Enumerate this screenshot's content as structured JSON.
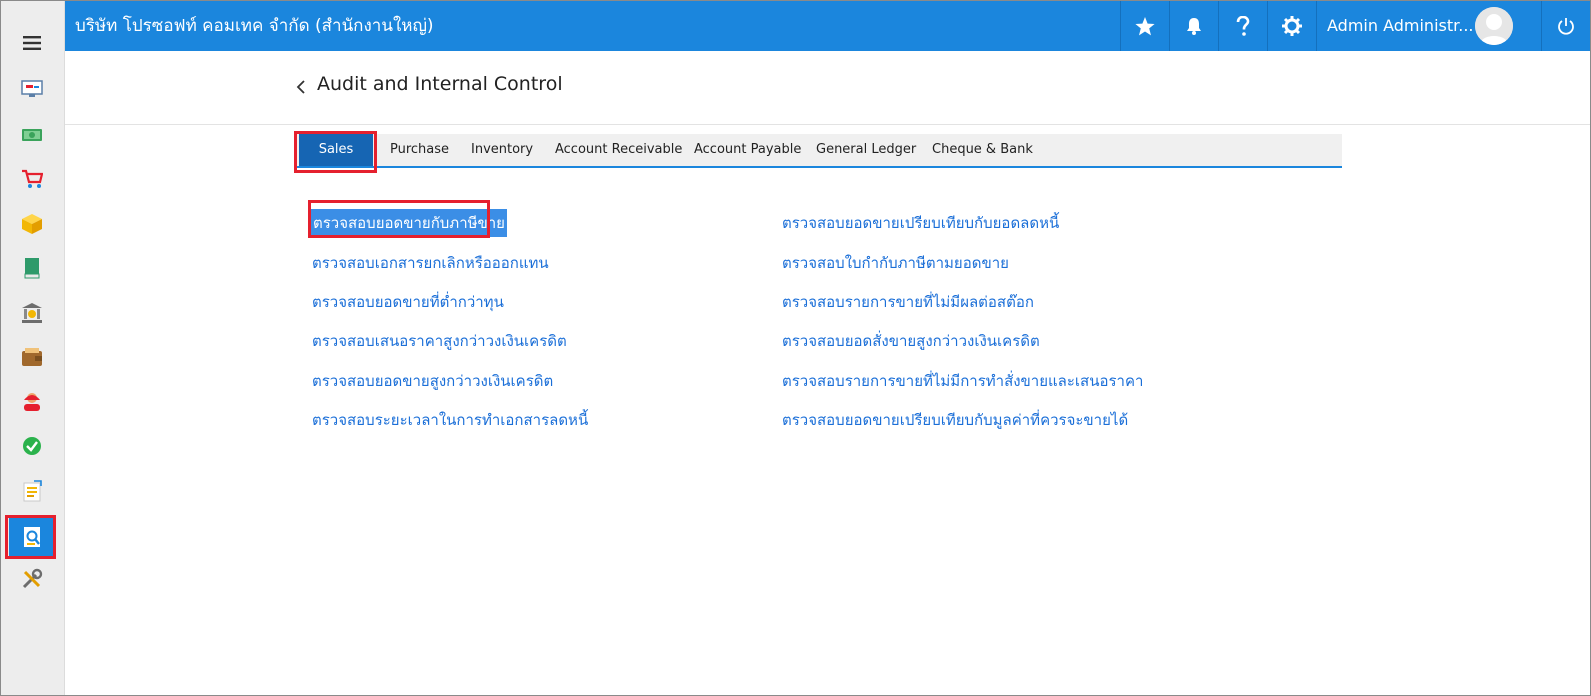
{
  "topbar": {
    "company": "บริษัท โปรซอฟท์ คอมเทค จำกัด (สำนักงานใหญ่)",
    "user_name": "Admin Administr...",
    "icons": [
      "star-icon",
      "bell-icon",
      "help-icon",
      "settings-icon",
      "power-icon"
    ]
  },
  "sidebar": {
    "items": [
      "menu-icon",
      "dashboard-icon",
      "cash-icon",
      "cart-icon",
      "box-icon",
      "book-icon",
      "bank-icon",
      "wallet-icon",
      "person-icon",
      "check-icon",
      "report-icon",
      "audit-icon",
      "tools-icon"
    ],
    "active": "audit-icon"
  },
  "page": {
    "title": "Audit and Internal Control"
  },
  "tabs": [
    {
      "label": "Sales"
    },
    {
      "label": "Purchase"
    },
    {
      "label": "Inventory"
    },
    {
      "label": "Account Receivable"
    },
    {
      "label": "Account Payable"
    },
    {
      "label": "General Ledger"
    },
    {
      "label": "Cheque & Bank"
    }
  ],
  "active_tab": "Sales",
  "links_left": [
    "ตรวจสอบยอดขายกับภาษีขาย",
    "ตรวจสอบเอกสารยกเลิกหรือออกแทน",
    "ตรวจสอบยอดขายที่ต่ำกว่าทุน",
    "ตรวจสอบเสนอราคาสูงกว่าวงเงินเครดิต",
    "ตรวจสอบยอดขายสูงกว่าวงเงินเครดิต",
    "ตรวจสอบระยะเวลาในการทำเอกสารลดหนี้"
  ],
  "links_right": [
    "ตรวจสอบยอดขายเปรียบเทียบกับยอดลดหนี้",
    "ตรวจสอบใบกำกับภาษีตามยอดขาย",
    "ตรวจสอบรายการขายที่ไม่มีผลต่อสต๊อก",
    "ตรวจสอบยอดสั่งขายสูงกว่าวงเงินเครดิต",
    "ตรวจสอบรายการขายที่ไม่มีการทำสั่งขายและเสนอราคา",
    "ตรวจสอบยอดขายเปรียบเทียบกับมูลค่าที่ควรจะขายได้"
  ],
  "colors": {
    "topbar": "#1b86dd",
    "active_tab": "#1665b3",
    "link": "#1b6fd8",
    "highlight": "#e5202e"
  }
}
